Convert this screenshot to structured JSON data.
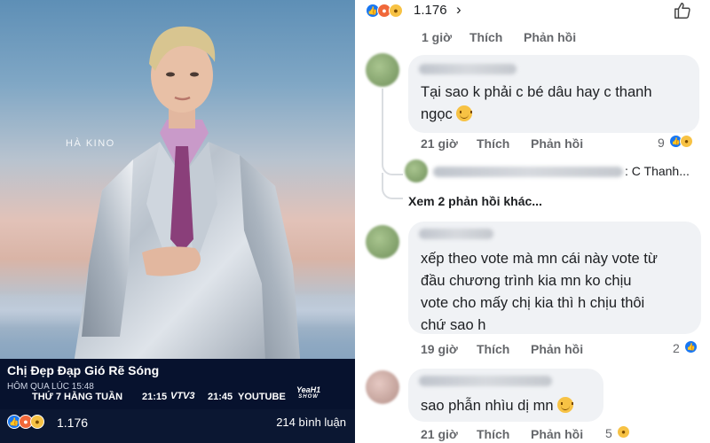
{
  "left_post": {
    "brand_tag": "HÀ KINO",
    "show_title": "Chị Đẹp Đạp Gió Rẽ Sóng",
    "time_label": "HÔM QUA LÚC 15:48",
    "schedule_day": "THỨ 7 HẰNG TUẦN",
    "schedule_time_1": "21:15",
    "channel_1": "VTV3",
    "schedule_time_2": "21:45",
    "channel_2": "YOUTUBE",
    "yeah1_logo": "YeaH1",
    "yeah1_sub": "SHOW",
    "reaction_count": "1.176",
    "comment_count": "214 bình luận"
  },
  "header": {
    "reaction_count": "1.176"
  },
  "comments": [
    {
      "time": "1 giờ",
      "like": "Thích",
      "reply": "Phản hồi"
    },
    {
      "text_line1": "Tại sao k phải c bé dâu hay c thanh",
      "text_line2": "ngọc",
      "time": "21 giờ",
      "like": "Thích",
      "reply": "Phản hồi",
      "reactions": "9"
    },
    {
      "reply_preview": ": C Thanh...",
      "more_replies": "Xem 2 phản hồi khác..."
    },
    {
      "text_lines": [
        "xếp theo vote mà mn cái này vote từ",
        "đầu chương trình kia mn ko chịu",
        "vote cho mấy chị kia thì h chịu thôi",
        "chứ sao h"
      ],
      "time": "19 giờ",
      "like": "Thích",
      "reply": "Phản hồi",
      "reactions": "2"
    },
    {
      "text": "sao phẫn nhìu dị mn",
      "time": "21 giờ",
      "like": "Thích",
      "reply": "Phản hồi",
      "reactions": "5"
    }
  ],
  "colors": {
    "accent": "#1877f2",
    "bubble": "#f0f2f5",
    "meta": "#65676b",
    "video_band": "#07122e"
  },
  "icons": [
    "like-icon",
    "angry-icon",
    "sad-icon",
    "haha-icon",
    "thumbs-up-icon",
    "chevron-right-icon"
  ]
}
